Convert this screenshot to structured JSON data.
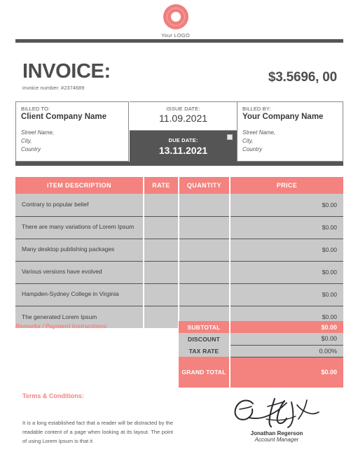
{
  "brand": {
    "logo_icon": "donut-logo-icon",
    "logo_caption": "Your LOGO",
    "accent_color": "#f4827e",
    "dark_color": "#555555",
    "row_color": "#c9c9c9"
  },
  "header": {
    "title": "INVOICE:",
    "invoice_number_label": "invoice number: #2374689",
    "amount": "$3.5696, 00"
  },
  "billing": {
    "billed_to_label": "BILLED TO:",
    "billed_to_name": "Client Company Name",
    "billed_to_address": "Street Name,\nCity,\nCountry",
    "billed_by_label": "BILLED BY:",
    "billed_by_name": "Your Company Name",
    "billed_by_address": "Street Name,\nCity,\nCountry",
    "issue_date_label": "ISSUE DATE:",
    "issue_date_value": "11.09.2021",
    "due_date_label": "DUE DATE:",
    "due_date_value": "13.11.2021"
  },
  "items_table": {
    "columns": [
      "iTEM DESCRIPTION",
      "RATE",
      "QUANTITY",
      "PRICE"
    ],
    "rows": [
      {
        "description": "Contrary to popular belief",
        "rate": "",
        "quantity": "",
        "price": "$0.00"
      },
      {
        "description": "There are many variations of Lorem Ipsum",
        "rate": "",
        "quantity": "",
        "price": "$0.00"
      },
      {
        "description": "Many desktop publishing packages",
        "rate": "",
        "quantity": "",
        "price": "$0.00"
      },
      {
        "description": "Various versions have evolved",
        "rate": "",
        "quantity": "",
        "price": "$0.00"
      },
      {
        "description": "Hampden-Sydney College in Virginia",
        "rate": "",
        "quantity": "",
        "price": "$0.00"
      },
      {
        "description": "The generated Lorem Ipsum",
        "rate": "",
        "quantity": "",
        "price": "$0.00"
      }
    ]
  },
  "remarks": {
    "label": "Remarks / Payment Instructions:"
  },
  "totals": {
    "subtotal_label": "SUBTOTAL",
    "subtotal_value": "$0.00",
    "discount_label": "DISCOUNT",
    "discount_value": "$0.00",
    "tax_rate_label": "TAX RATE",
    "tax_rate_value": "0.00%",
    "grand_total_label": "GRAND TOTAL",
    "grand_total_value": "$0.00"
  },
  "terms": {
    "title": "Terms & Conditions:",
    "body": "It is a long established fact that a reader will be distracted by the readable content of a page when looking at its layout. The point of using Lorem Ipsum is that it"
  },
  "signature": {
    "icon": "handwritten-signature-icon",
    "name": "Jonathan Regerson",
    "role": "Account Manager"
  }
}
